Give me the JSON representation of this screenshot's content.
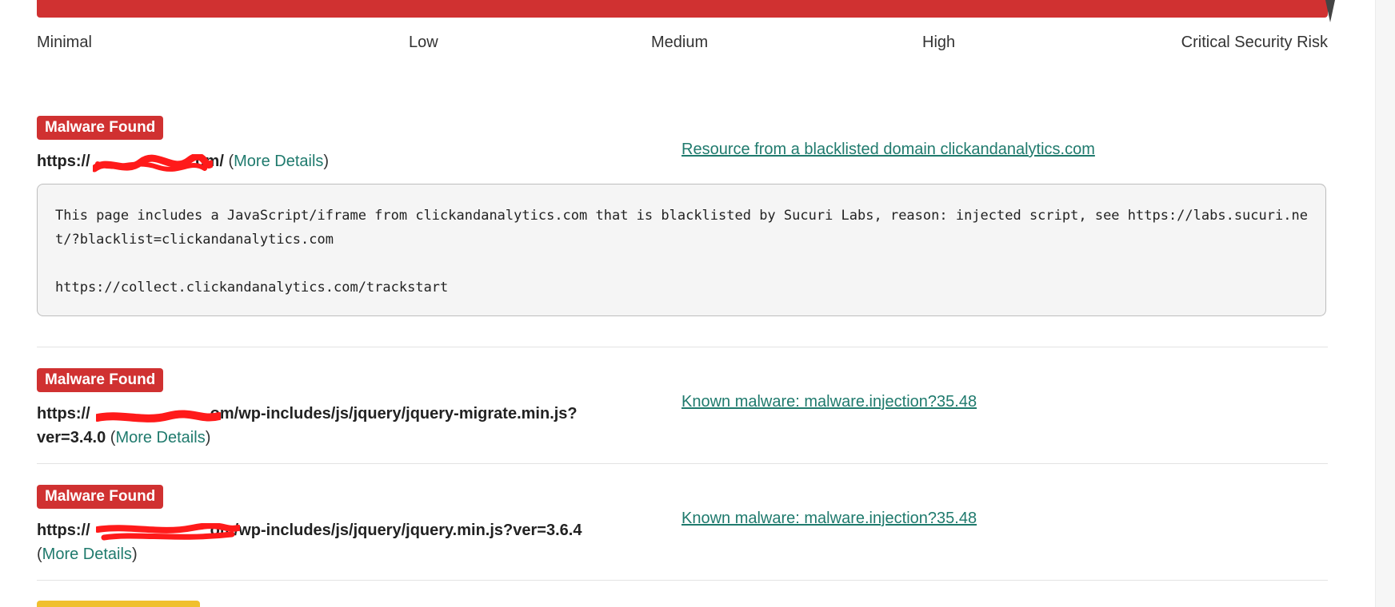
{
  "risk_meter": {
    "bar_color": "#d03131",
    "level": "Critical Security Risk",
    "labels": [
      "Minimal",
      "Low",
      "Medium",
      "High",
      "Critical Security Risk"
    ]
  },
  "findings": [
    {
      "badge": "Malware Found",
      "badge_color": "#d03131",
      "url_prefix": "https://",
      "url_suffix": ".com/",
      "more_details": "More Details",
      "threat": "Resource from a blacklisted domain clickandanalytics.com",
      "detail_line_1": "This page includes a JavaScript/iframe from clickandanalytics.com that is blacklisted by Sucuri Labs, reason: injected script, see https://labs.sucuri.net/?blacklist=clickandanalytics.com",
      "detail_line_2": "https://collect.clickandanalytics.com/trackstart"
    },
    {
      "badge": "Malware Found",
      "badge_color": "#d03131",
      "url_prefix": "https://",
      "url_suffix": "om/wp-includes/js/jquery/jquery-migrate.min.js?ver=3.4.0",
      "more_details": "More Details",
      "threat": "Known malware: malware.injection?35.48"
    },
    {
      "badge": "Malware Found",
      "badge_color": "#d03131",
      "url_prefix": "https://",
      "url_suffix": "om/wp-includes/js/jquery/jquery.min.js?ver=3.6.4",
      "more_details": "More Details",
      "threat": "Known malware: malware.injection?35.48"
    }
  ],
  "next_badge_color": "#f0c02f",
  "link_color": "#1f7a6d"
}
